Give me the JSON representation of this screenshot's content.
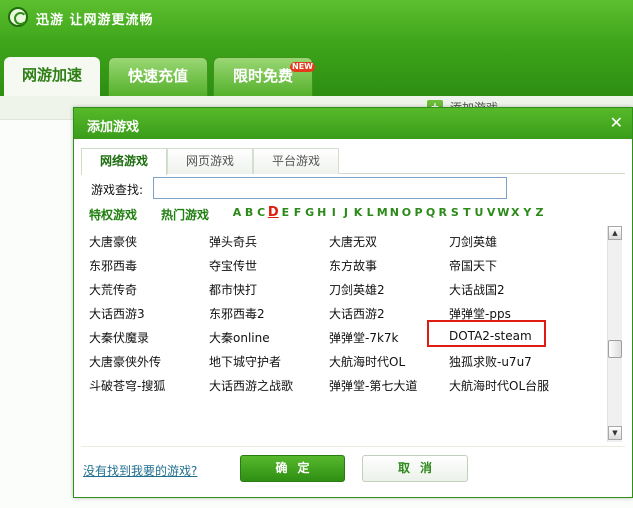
{
  "app": {
    "title": "迅游  让网游更流畅",
    "tabs": [
      {
        "label": "网游加速"
      },
      {
        "label": "快速充值"
      },
      {
        "label": "限时免费"
      }
    ],
    "new_badge": "NEW",
    "add_game_link": "添加游戏"
  },
  "dialog": {
    "title": "添加游戏",
    "close_icon": "close-icon",
    "tabs": [
      {
        "label": "网络游戏"
      },
      {
        "label": "网页游戏"
      },
      {
        "label": "平台游戏"
      }
    ],
    "search": {
      "label": "游戏查找:",
      "value": "",
      "placeholder": ""
    },
    "filters": {
      "categories": [
        "特权游戏",
        "热门游戏"
      ],
      "letters": [
        "A",
        "B",
        "C",
        "D",
        "E",
        "F",
        "G",
        "H",
        "I",
        "J",
        "K",
        "L",
        "M",
        "N",
        "O",
        "P",
        "Q",
        "R",
        "S",
        "T",
        "U",
        "V",
        "W",
        "X",
        "Y",
        "Z"
      ],
      "current_letter": "D"
    },
    "games": [
      [
        "大唐豪侠",
        "弹头奇兵",
        "大唐无双",
        "刀剑英雄"
      ],
      [
        "东邪西毒",
        "夺宝传世",
        "东方故事",
        "帝国天下"
      ],
      [
        "大荒传奇",
        "都市快打",
        "刀剑英雄2",
        "大话战国2"
      ],
      [
        "大话西游3",
        "东邪西毒2",
        "大话西游2",
        "弹弹堂-pps"
      ],
      [
        "大秦伏魔录",
        "大秦online",
        "弹弹堂-7k7k",
        "DOTA2-steam"
      ],
      [
        "大唐豪侠外传",
        "地下城守护者",
        "大航海时代OL",
        "独孤求败-u7u7"
      ],
      [
        "斗破苍穹-搜狐",
        "大话西游之战歌",
        "弹弹堂-第七大道",
        "大航海时代OL台服"
      ]
    ],
    "highlighted_game": "DOTA2-steam",
    "highlight_color": "#e01b14",
    "scroll": {
      "up_icon": "scroll-up-icon",
      "down_icon": "scroll-down-icon"
    },
    "not_found_link": "没有找到我要的游戏?",
    "ok_label": "确定",
    "cancel_label": "取消"
  },
  "colors": {
    "accent": "#3ea51b",
    "active_letter": "#e01b0b"
  }
}
